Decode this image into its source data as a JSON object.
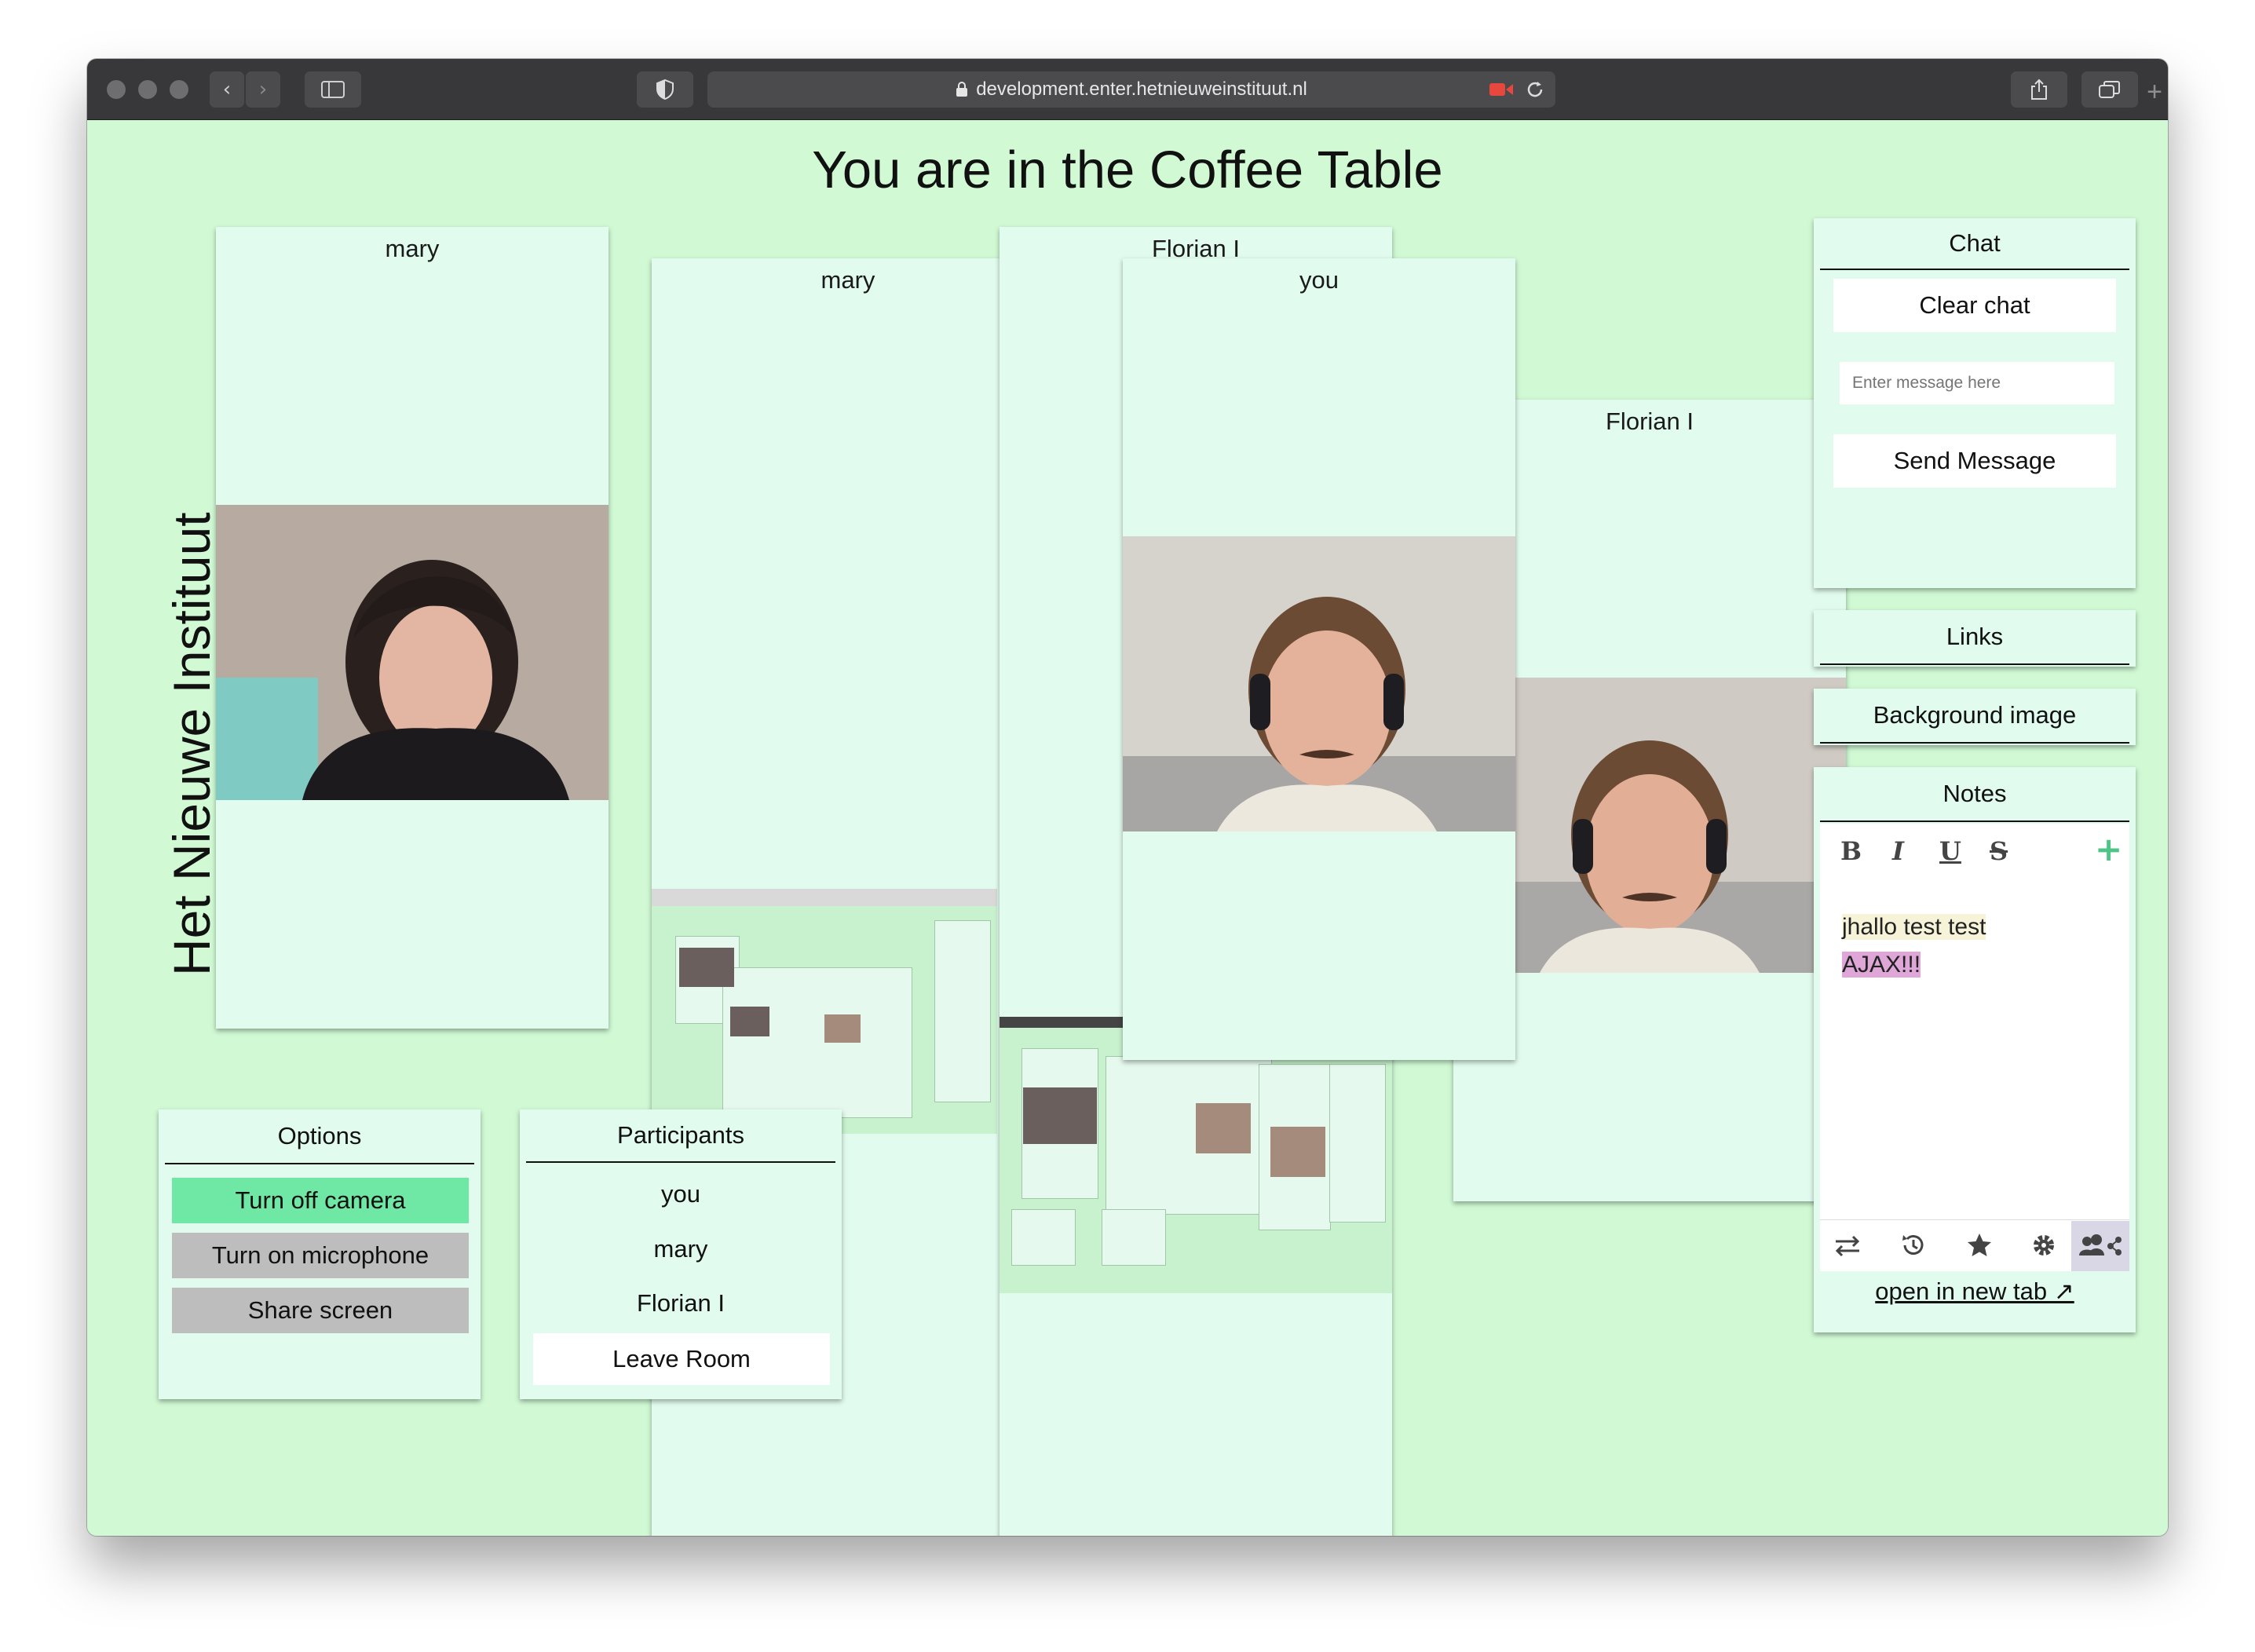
{
  "browser": {
    "url": "development.enter.hetnieuweinstituut.nl"
  },
  "page": {
    "title": "You are in the Coffee Table",
    "brand": "Het Nieuwe Instituut"
  },
  "video_tiles": [
    {
      "label": "mary"
    },
    {
      "label": "mary"
    },
    {
      "label": "Florian I"
    },
    {
      "label": "you"
    },
    {
      "label": "Florian I"
    }
  ],
  "chat": {
    "header": "Chat",
    "clear_label": "Clear chat",
    "message_placeholder": "Enter message here",
    "send_label": "Send Message"
  },
  "links": {
    "header": "Links"
  },
  "background": {
    "header": "Background image"
  },
  "notes": {
    "header": "Notes",
    "toolbar": [
      "B",
      "I",
      "U",
      "S"
    ],
    "line1": "jhallo test test",
    "line2": "AJAX!!!",
    "open_link": "open in new tab ↗",
    "highlight1": "#f6f3d9",
    "highlight2": "#dfa6d8"
  },
  "options": {
    "header": "Options",
    "camera_label": "Turn off camera",
    "mic_label": "Turn on microphone",
    "share_label": "Share screen",
    "active_color": "#6ee8a4",
    "inactive_color": "#bdbdbd"
  },
  "participants": {
    "header": "Participants",
    "names": [
      "you",
      "mary",
      "Florian I"
    ],
    "leave_label": "Leave Room"
  }
}
